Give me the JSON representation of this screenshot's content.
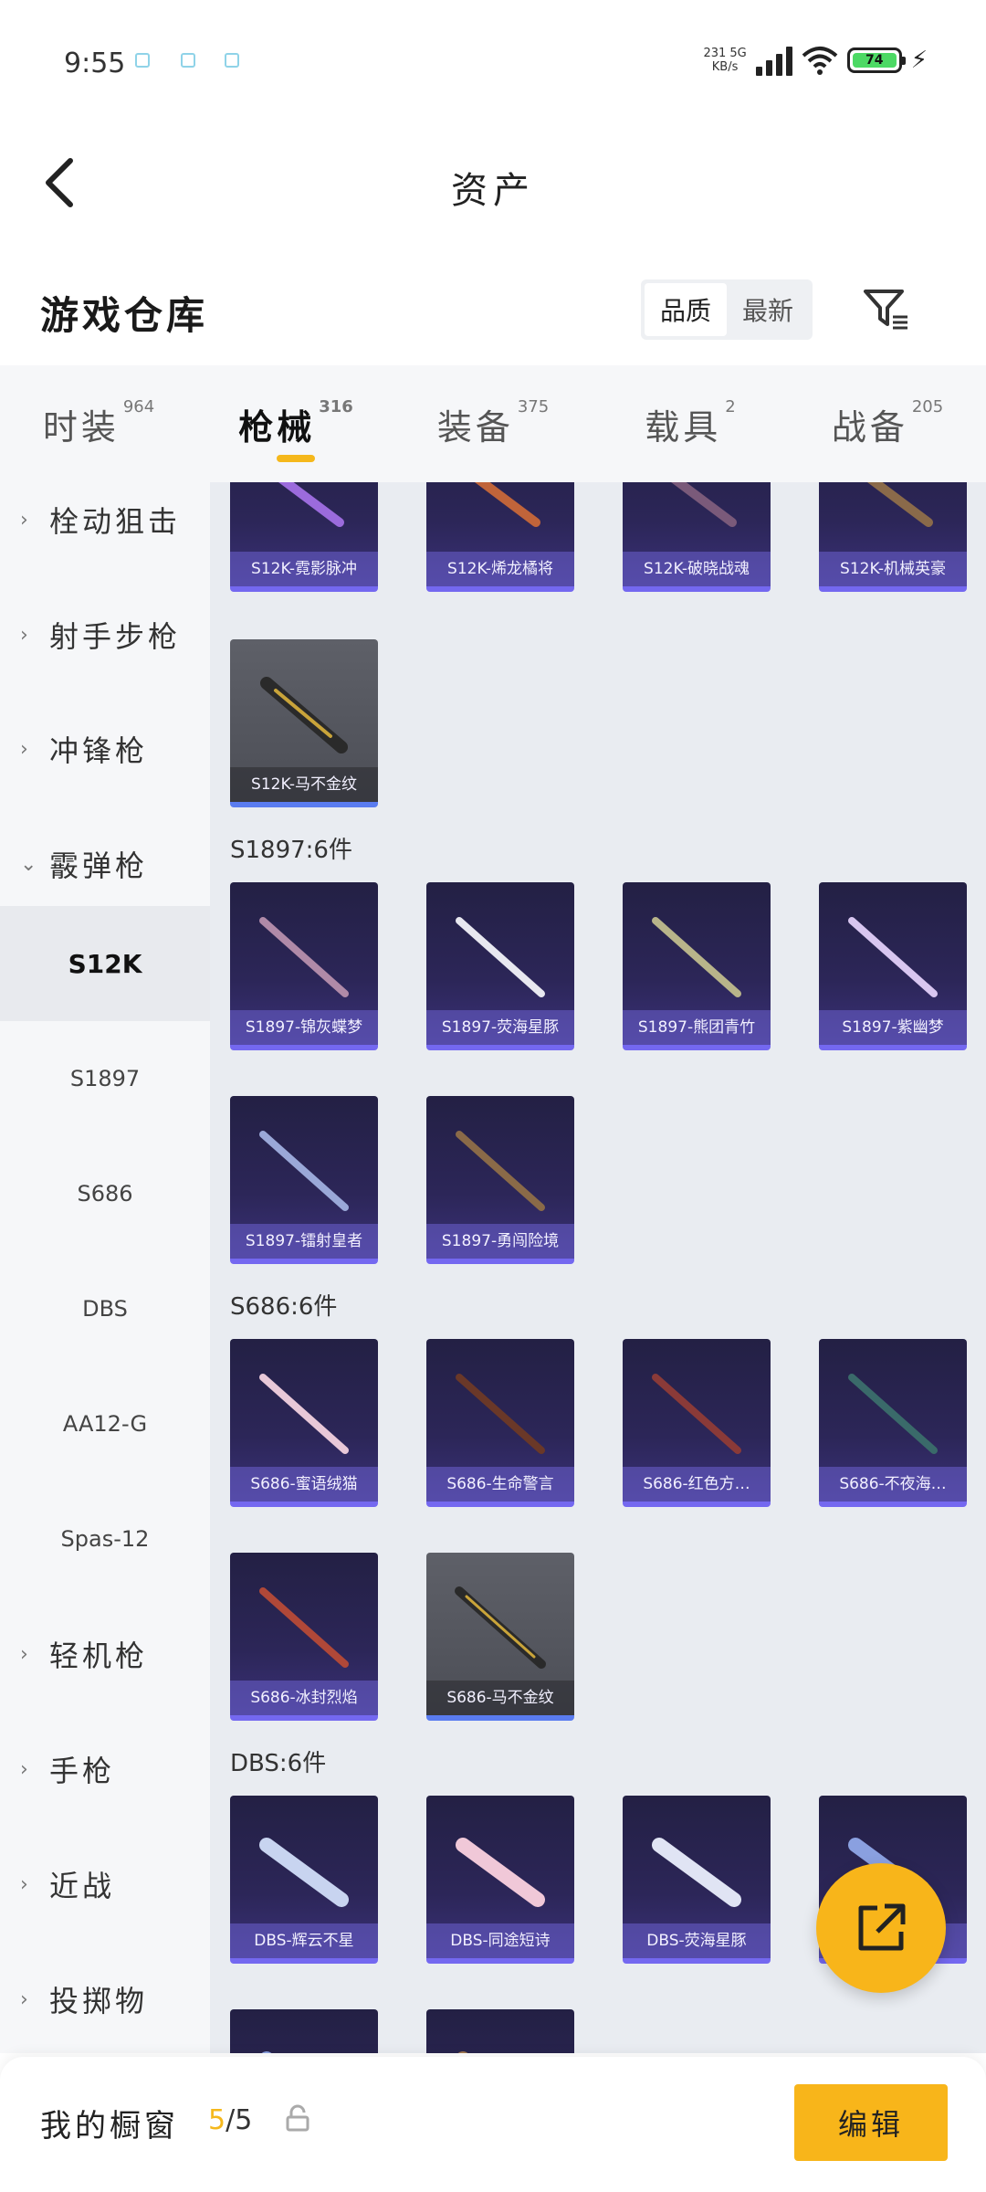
{
  "status_bar": {
    "time": "9:55",
    "net_speed_top": "231 5G",
    "net_speed_bottom": "KB/s",
    "battery": "74",
    "icons": [
      "notification-icon",
      "signal-icon",
      "wifi-icon",
      "battery-icon",
      "charging-icon"
    ]
  },
  "header": {
    "title": "资产",
    "back_icon": "back-chevron-icon"
  },
  "warehouse": {
    "title": "游戏仓库",
    "sort_options": [
      {
        "label": "品质",
        "active": true
      },
      {
        "label": "最新",
        "active": false
      }
    ],
    "filter_icon": "filter-icon"
  },
  "tabs": [
    {
      "label": "时装",
      "count": "964",
      "active": false
    },
    {
      "label": "枪械",
      "count": "316",
      "active": true
    },
    {
      "label": "装备",
      "count": "375",
      "active": false
    },
    {
      "label": "载具",
      "count": "2",
      "active": false
    },
    {
      "label": "战备",
      "count": "205",
      "active": false
    }
  ],
  "sidebar": {
    "items": [
      {
        "label": "栓动狙击",
        "type": "category",
        "expanded": false
      },
      {
        "label": "射手步枪",
        "type": "category",
        "expanded": false
      },
      {
        "label": "冲锋枪",
        "type": "category",
        "expanded": false
      },
      {
        "label": "霰弹枪",
        "type": "category",
        "expanded": true
      },
      {
        "label": "S12K",
        "type": "sub",
        "selected": true
      },
      {
        "label": "S1897",
        "type": "sub",
        "selected": false
      },
      {
        "label": "S686",
        "type": "sub",
        "selected": false
      },
      {
        "label": "DBS",
        "type": "sub",
        "selected": false
      },
      {
        "label": "AA12-G",
        "type": "sub",
        "selected": false
      },
      {
        "label": "Spas-12",
        "type": "sub",
        "selected": false
      },
      {
        "label": "轻机枪",
        "type": "category",
        "expanded": false
      },
      {
        "label": "手枪",
        "type": "category",
        "expanded": false
      },
      {
        "label": "近战",
        "type": "category",
        "expanded": false
      },
      {
        "label": "投掷物",
        "type": "category",
        "expanded": false
      }
    ]
  },
  "content": {
    "s12k_items": [
      {
        "label": "S12K-霓影脉冲",
        "style": "purple"
      },
      {
        "label": "S12K-烯龙橘将",
        "style": "purple"
      },
      {
        "label": "S12K-破晓战魂",
        "style": "purple"
      },
      {
        "label": "S12K-机械英豪",
        "style": "purple"
      },
      {
        "label": "S12K-马不金纹",
        "style": "gold"
      }
    ],
    "sections": [
      {
        "header": "S1897:6件",
        "items": [
          {
            "label": "S1897-锦灰蝶梦",
            "style": "purple"
          },
          {
            "label": "S1897-荧海星豚",
            "style": "purple"
          },
          {
            "label": "S1897-熊团青竹",
            "style": "purple"
          },
          {
            "label": "S1897-紫幽梦",
            "style": "purple"
          },
          {
            "label": "S1897-镭射皇者",
            "style": "purple"
          },
          {
            "label": "S1897-勇闯险境",
            "style": "purple"
          }
        ]
      },
      {
        "header": "S686:6件",
        "items": [
          {
            "label": "S686-蜜语绒猫",
            "style": "purple"
          },
          {
            "label": "S686-生命警言",
            "style": "purple"
          },
          {
            "label": "S686-红色方…",
            "style": "purple"
          },
          {
            "label": "S686-不夜海…",
            "style": "purple"
          },
          {
            "label": "S686-冰封烈焰",
            "style": "purple"
          },
          {
            "label": "S686-马不金纹",
            "style": "gold"
          }
        ]
      },
      {
        "header": "DBS:6件",
        "items": [
          {
            "label": "DBS-辉云不星",
            "style": "purple"
          },
          {
            "label": "DBS-同途短诗",
            "style": "purple"
          },
          {
            "label": "DBS-荧海星豚",
            "style": "purple"
          },
          {
            "label": "",
            "style": "purple"
          },
          {
            "label": "",
            "style": "purple"
          },
          {
            "label": "",
            "style": "purple"
          }
        ]
      }
    ]
  },
  "fab": {
    "icon": "share-external-icon"
  },
  "bottom_bar": {
    "title": "我的橱窗",
    "count_current": "5",
    "count_sep_total": "/5",
    "lock_icon": "lock-icon",
    "edit_label": "编辑"
  },
  "colors": {
    "accent": "#f8b51a",
    "card_bg": "#2c2658",
    "card_border": "#7468f0",
    "content_bg": "#e9ecf1",
    "sidebar_bg": "#f6f7f9"
  }
}
